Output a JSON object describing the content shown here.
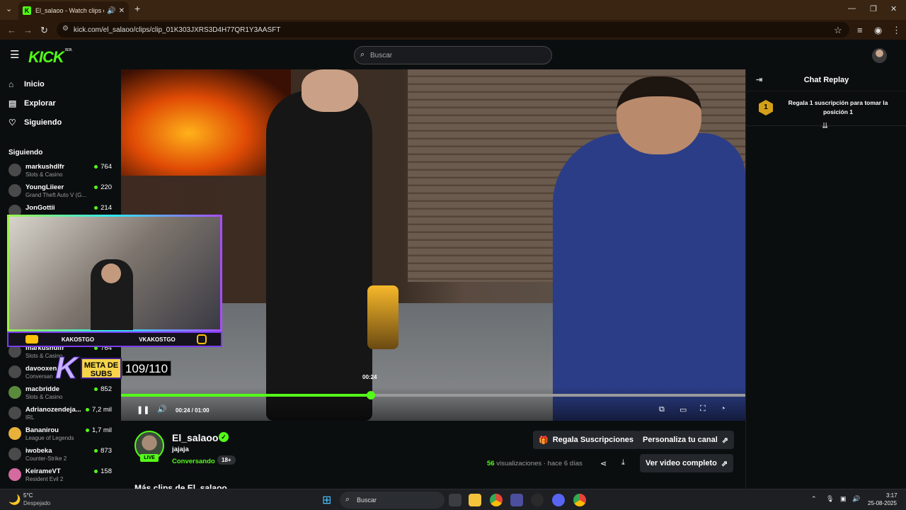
{
  "browser": {
    "tab_title": "El_salaoo - Watch clips on K",
    "url": "kick.com/el_salaoo/clips/clip_01K303JXRS3D4H77QR1Y3AASFT"
  },
  "header": {
    "logo": "KICK",
    "beta": "BETA",
    "search_placeholder": "Buscar"
  },
  "sidebar": {
    "nav": [
      {
        "label": "Inicio",
        "icon": "home-icon"
      },
      {
        "label": "Explorar",
        "icon": "explore-icon"
      },
      {
        "label": "Siguiendo",
        "icon": "heart-icon"
      }
    ],
    "section_label": "Siguiendo",
    "following": [
      {
        "name": "markushdlfr",
        "category": "Slots & Casino",
        "viewers": "764"
      },
      {
        "name": "YoungLiieer",
        "category": "Grand Theft Auto V (G...",
        "viewers": "220"
      },
      {
        "name": "JonGottii",
        "category": "",
        "viewers": "214"
      },
      {
        "name": "markushdlfr",
        "category": "Slots & Casino",
        "viewers": "764"
      },
      {
        "name": "davooxen",
        "category": "Conversan",
        "viewers": ""
      },
      {
        "name": "macbridde",
        "category": "Slots & Casino",
        "viewers": "852"
      },
      {
        "name": "Adrianozendeja...",
        "category": "IRL",
        "viewers": "7,2 mil"
      },
      {
        "name": "Bananirou",
        "category": "League of Legends",
        "viewers": "1,7 mil"
      },
      {
        "name": "iwobeka",
        "category": "Counter-Strike 2",
        "viewers": "873"
      },
      {
        "name": "KeirameVT",
        "category": "Resident Evil 2",
        "viewers": "158"
      }
    ]
  },
  "overlay": {
    "handle_left": "KAKOSTGO",
    "handle_right": "VKAKOSTGO",
    "meta_label": "META DE SUBS",
    "meta_count": "109/110"
  },
  "player": {
    "progress": 0.4,
    "tooltip_time": "00:24",
    "timecode": "00:24 / 01:00"
  },
  "chat": {
    "title": "Chat Replay",
    "gift_rank": "1",
    "gift_text": "Regala 1 suscripción para tomar la posición 1"
  },
  "channel": {
    "name": "El_salaoo",
    "live": "LIVE",
    "clip_title": "jajaja",
    "category": "Conversando",
    "age": "18+",
    "gift_button": "Regala Suscripciones",
    "customize_button": "Personaliza tu canal",
    "views_count": "56",
    "views_label": "visualizaciones",
    "ago": "hace 6 días",
    "full_video_button": "Ver video completo",
    "more_clips": "Más clips de El_salaoo"
  },
  "taskbar": {
    "weather_temp": "5°C",
    "weather_desc": "Despejado",
    "search": "Buscar",
    "time": "3:17",
    "date": "25-08-2025"
  },
  "colors": {
    "accent": "#53fc18",
    "background": "#0b0e0f"
  }
}
